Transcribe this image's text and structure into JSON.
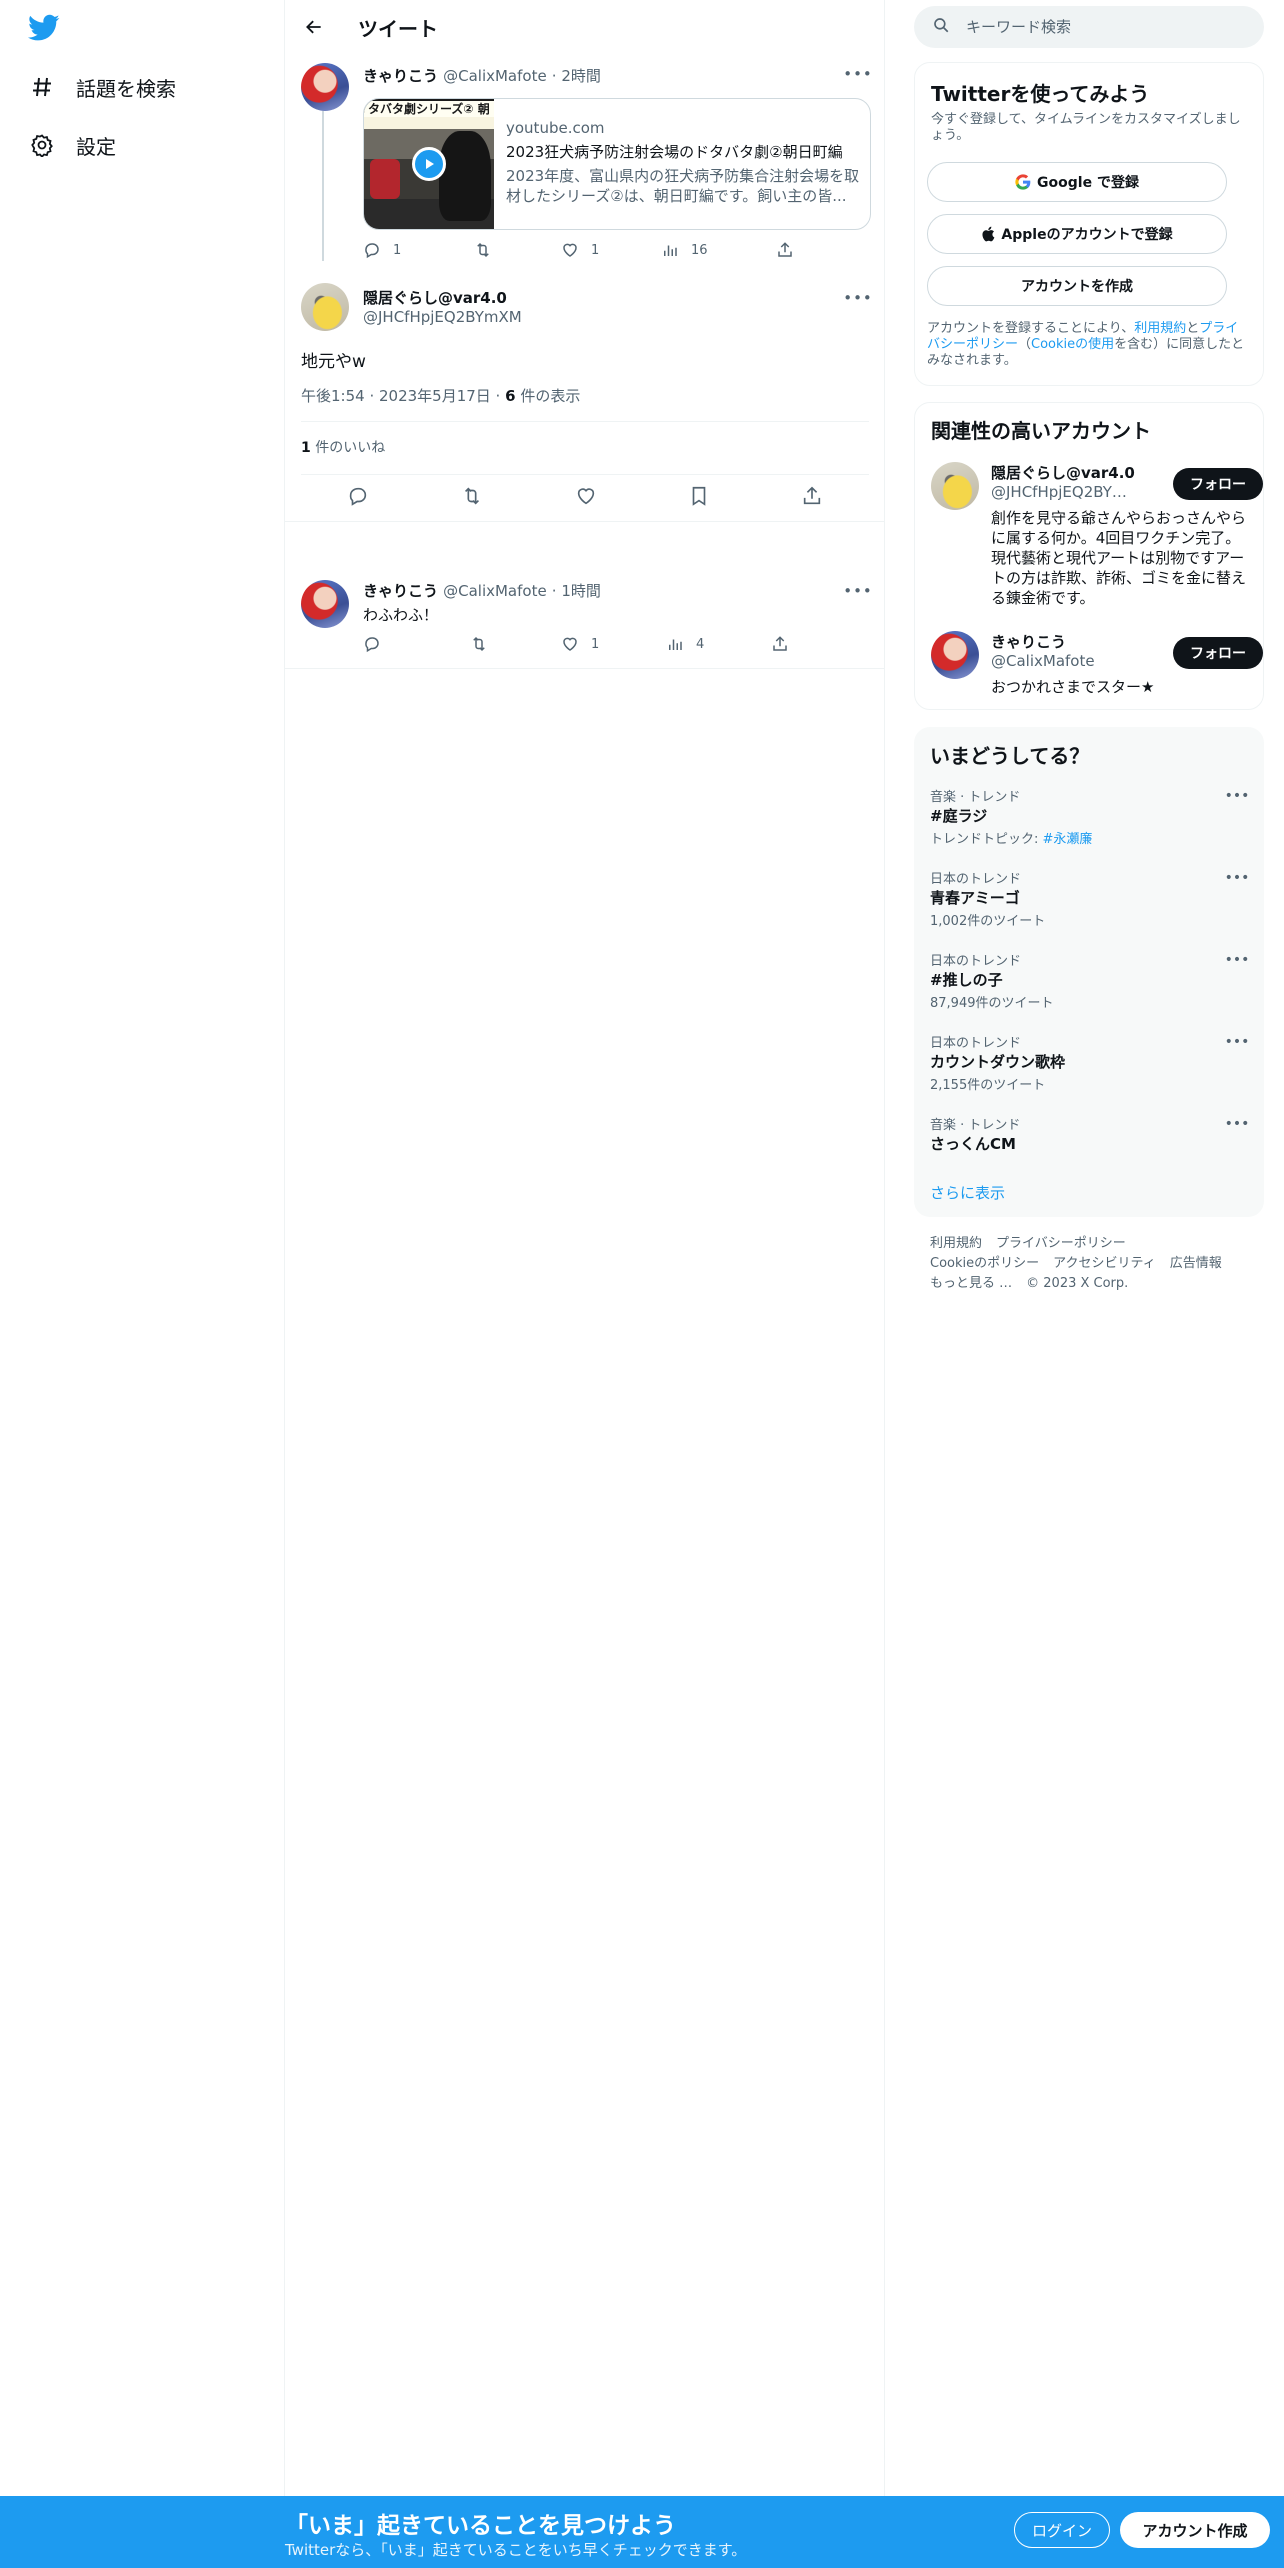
{
  "nav": {
    "items": [
      {
        "label": "話題を検索",
        "icon": "hashtag-icon"
      },
      {
        "label": "設定",
        "icon": "gear-icon"
      }
    ]
  },
  "main": {
    "title": "ツイート",
    "parent_tweet": {
      "name": "きゃりこう",
      "handle": "@CalixMafote",
      "time": "· 2時間",
      "card": {
        "thumb_text": "タバタ劇シリーズ② 朝",
        "domain": "youtube.com",
        "title": "2023狂犬病予防注射会場のドタバタ劇②朝日町編",
        "description": "2023年度、富山県内の狂犬病予防集合注射会場を取材したシリーズ②は、朝日町編です。飼い主の皆..."
      },
      "replies": "1",
      "retweets": "",
      "likes": "1",
      "views": "16"
    },
    "focus_tweet": {
      "name": "隠居ぐらし@var4.0",
      "handle": "@JHCfHpjEQ2BYmXM",
      "text": "地元やw",
      "timestamp": "午後1:54 · 2023年5月17日 · ",
      "views_count": "6",
      "views_label": " 件の表示",
      "likes_count": "1",
      "likes_label": " 件のいいね"
    },
    "reply_tweet": {
      "name": "きゃりこう",
      "handle": "@CalixMafote",
      "time": "· 1時間",
      "text": "わふわふ！",
      "replies": "",
      "retweets": "",
      "likes": "1",
      "views": "4"
    }
  },
  "sidebar": {
    "search_placeholder": "キーワード検索",
    "signup": {
      "title": "Twitterを使ってみよう",
      "subtitle": "今すぐ登録して、タイムラインをカスタマイズしましょう。",
      "google": "Google で登録",
      "apple": "Appleのアカウントで登録",
      "create": "アカウントを作成",
      "legal_prefix": "アカウントを登録することにより、",
      "legal_terms": "利用規約",
      "legal_and": "と",
      "legal_privacy": "プライバシーポリシー",
      "legal_paren_open": "（",
      "legal_cookie": "Cookieの使用",
      "legal_suffix": "を含む）に同意したとみなされます。"
    },
    "relevant": {
      "title": "関連性の高いアカウント",
      "follow_label": "フォロー",
      "accounts": [
        {
          "name": "隠居ぐらし@var4.0",
          "handle": "@JHCfHpjEQ2BYmXM",
          "bio": "創作を見守る爺さんやらおっさんやらに属する何か。4回目ワクチン完了。現代藝術と現代アートは別物ですアートの方は詐欺、詐術、ゴミを金に替える錬金術です。"
        },
        {
          "name": "きゃりこう",
          "handle": "@CalixMafote",
          "bio": "おつかれさまでスター★"
        }
      ]
    },
    "trends": {
      "title": "いまどうしてる？",
      "items": [
        {
          "context": "音楽 · トレンド",
          "name": "#庭ラジ",
          "sub_prefix": "トレンドトピック: ",
          "sub_highlight": "#永瀬廉"
        },
        {
          "context": "日本のトレンド",
          "name": "青春アミーゴ",
          "sub_prefix": "1,002件のツイート",
          "sub_highlight": ""
        },
        {
          "context": "日本のトレンド",
          "name": "#推しの子",
          "sub_prefix": "87,949件のツイート",
          "sub_highlight": ""
        },
        {
          "context": "日本のトレンド",
          "name": "カウントダウン歌枠",
          "sub_prefix": "2,155件のツイート",
          "sub_highlight": ""
        },
        {
          "context": "音楽 · トレンド",
          "name": "さっくんCM",
          "sub_prefix": "",
          "sub_highlight": ""
        }
      ],
      "show_more": "さらに表示"
    },
    "footer": [
      "利用規約",
      "プライバシーポリシー",
      "Cookieのポリシー",
      "アクセシビリティ",
      "広告情報",
      "もっと見る …",
      "© 2023 X Corp."
    ]
  },
  "bottom_bar": {
    "title": "「いま」起きていることを見つけよう",
    "subtitle": "Twitterなら、「いま」起きていることをいち早くチェックできます。",
    "login": "ログイン",
    "signup": "アカウント作成"
  },
  "colors": {
    "accent": "#1d9bf0",
    "text": "#0f1419",
    "muted": "#536471",
    "border": "#eff3f4"
  }
}
